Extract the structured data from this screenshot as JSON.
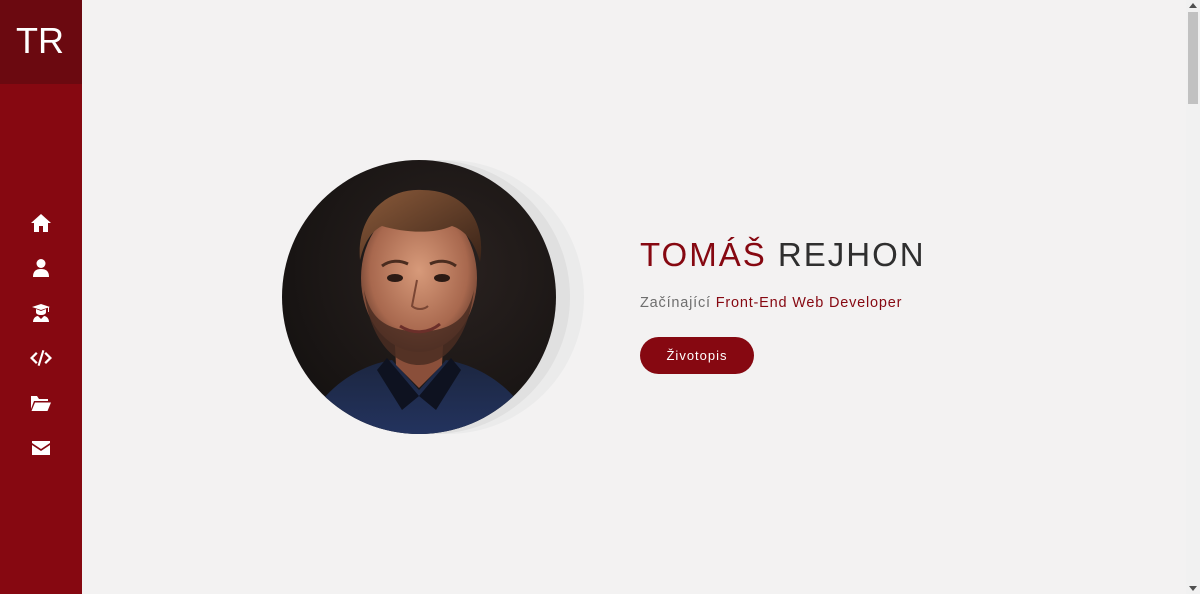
{
  "sidebar": {
    "logo_text": "TR",
    "nav": [
      {
        "icon": "home-icon",
        "name": "nav-home"
      },
      {
        "icon": "user-icon",
        "name": "nav-about"
      },
      {
        "icon": "graduation-icon",
        "name": "nav-education"
      },
      {
        "icon": "code-icon",
        "name": "nav-skills"
      },
      {
        "icon": "folder-open-icon",
        "name": "nav-projects"
      },
      {
        "icon": "envelope-icon",
        "name": "nav-contact"
      }
    ]
  },
  "hero": {
    "first_name": "TOMÁŠ",
    "last_name": "REJHON",
    "subtitle_prefix": "Začínající",
    "subtitle_role": "Front-End Web Developer",
    "button_label": "Životopis"
  },
  "colors": {
    "brand": "#860811",
    "brand_dark": "#6b0910",
    "background": "#f3f2f2",
    "text_dark": "#2f2f2f"
  }
}
